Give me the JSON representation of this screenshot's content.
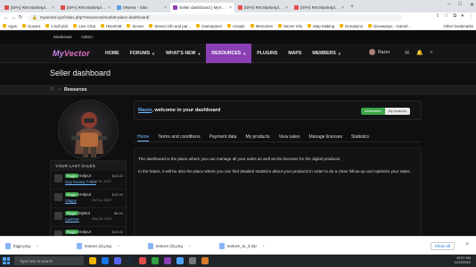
{
  "browser": {
    "tabs": [
      {
        "label": "[SPA] RM Marketplace/Shop - th",
        "color": "#e04b4b"
      },
      {
        "label": "[SPA] RM Marketplace/Shop - th",
        "color": "#e04b4b"
      },
      {
        "label": "nReest - Slim",
        "color": "#5aa0e0"
      },
      {
        "label": "Seller dashboard | MyVector Ro",
        "color": "#8a3fb5",
        "active": true
      },
      {
        "label": "[SPA] RM Marketplace/Shop - th",
        "color": "#e04b4b"
      },
      {
        "label": "[SPA] RM Marketplace/Shop - th",
        "color": "#e04b4b"
      }
    ],
    "url": "myvector.xyz/index.php?resources/market-place-dashboard/",
    "bookmarks": [
      "Apps",
      "Gusset",
      "1 bull pick",
      "Live Chat",
      "Hitesh38",
      "Server",
      "Server info and par...",
      "Gamepanel",
      "Arcade",
      "Memories",
      "Server info",
      "Map Making",
      "Donations",
      "Giveaways - Gamel..."
    ],
    "bookmarks_right": "Other bookmarks"
  },
  "site": {
    "topbar_links": [
      "Moderator",
      "Admin"
    ],
    "logo": {
      "main": "My",
      "accent": "Vector"
    },
    "menu": [
      {
        "label": "HOME"
      },
      {
        "label": "FORUMS",
        "caret": true
      },
      {
        "label": "WHAT'S NEW",
        "caret": true
      },
      {
        "label": "RESOURCES",
        "caret": true,
        "active": true
      },
      {
        "label": "PLUGINS"
      },
      {
        "label": "MAPS"
      },
      {
        "label": "MEMBERS",
        "caret": true
      }
    ],
    "username": "Razor",
    "page_title": "Seller dashboard",
    "breadcrumb": "Resources"
  },
  "sales": {
    "heading": "YOUR LAST SALES",
    "items": [
      {
        "badge": "Plugin",
        "name": "HelpUI",
        "price": "$15.00",
        "buyer": "Gay Society T-Rex",
        "date": "Oct 19, 2022"
      },
      {
        "badge": "Plugin",
        "name": "HelpUI",
        "price": "$15.00",
        "buyer": "Slappy",
        "date": "Oct 14, 2022"
      },
      {
        "badge": "Plugin",
        "name": "MyBot",
        "price": "$6.00",
        "buyer": "CashOK",
        "date": "Sep 23, 2022"
      },
      {
        "badge": "Plugin",
        "name": "HelpUI",
        "price": "$15.00",
        "buyer": "",
        "date": ""
      }
    ]
  },
  "welcome": {
    "user_link": "Razor",
    "text": ", welcome in your dashboard",
    "toggle_on": "Whitelisted",
    "toggle_off": "My products"
  },
  "tabs": [
    "Home",
    "Terms and conditions",
    "Payment data",
    "My products",
    "View sales",
    "Manage licenses",
    "Statistics"
  ],
  "body": {
    "p1": "The dashboard is the place where you can manage all your sales as well as the licenses for the digital products.",
    "p2": "In the future, it will be also the place where you can find detailed statistics about your products in order to do a close follow-up and optimize your sales."
  },
  "downloads": {
    "items": [
      "fogjo.png",
      "texture (4).png",
      "texture (3).png",
      "texture_to_3.zip"
    ],
    "show_all": "Show all"
  },
  "taskbar": {
    "search_placeholder": "Type here to search",
    "time": "10:57 AM",
    "date": "11/13/2022"
  }
}
